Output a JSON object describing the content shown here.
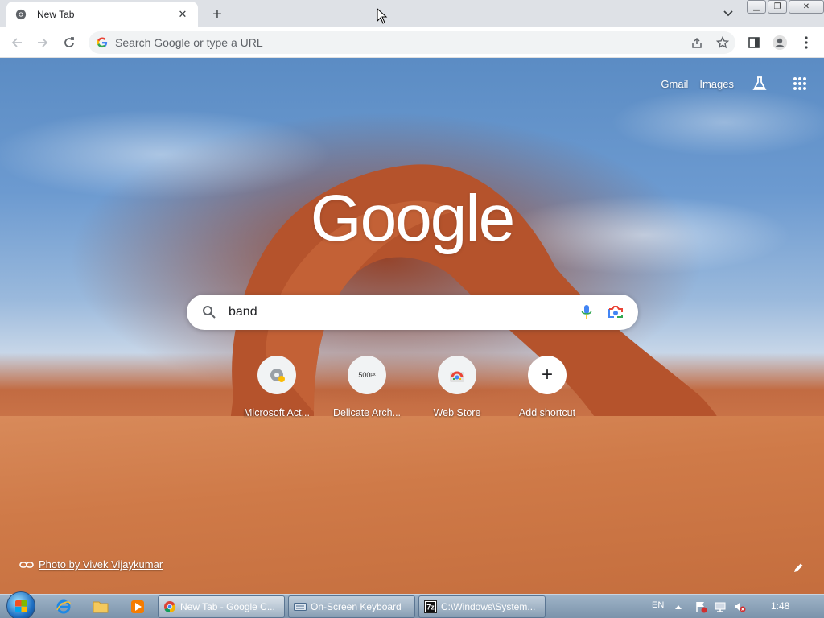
{
  "tab": {
    "title": "New Tab"
  },
  "omnibox": {
    "placeholder": "Search Google or type a URL"
  },
  "ntp": {
    "links": {
      "gmail": "Gmail",
      "images": "Images"
    },
    "logo": "Google",
    "search": {
      "value": "band"
    },
    "shortcuts": [
      {
        "label": "Microsoft Act...",
        "icon": "gear-icon"
      },
      {
        "label": "Delicate Arch...",
        "icon": "500px-logo"
      },
      {
        "label": "Web Store",
        "icon": "chrome-web-store-icon"
      },
      {
        "label": "Add shortcut",
        "icon": "plus-icon"
      }
    ],
    "attribution": "Photo by Vivek Vijaykumar"
  },
  "taskbar": {
    "buttons": [
      {
        "label": "New Tab - Google C..."
      },
      {
        "label": "On-Screen Keyboard"
      },
      {
        "label": "C:\\Windows\\System..."
      }
    ],
    "lang": "EN",
    "time": "1:48"
  },
  "colors": {
    "accent_blue": "#1a73e8",
    "mic_blue": "#4285f4",
    "taskbar": "#8aa2ba"
  }
}
